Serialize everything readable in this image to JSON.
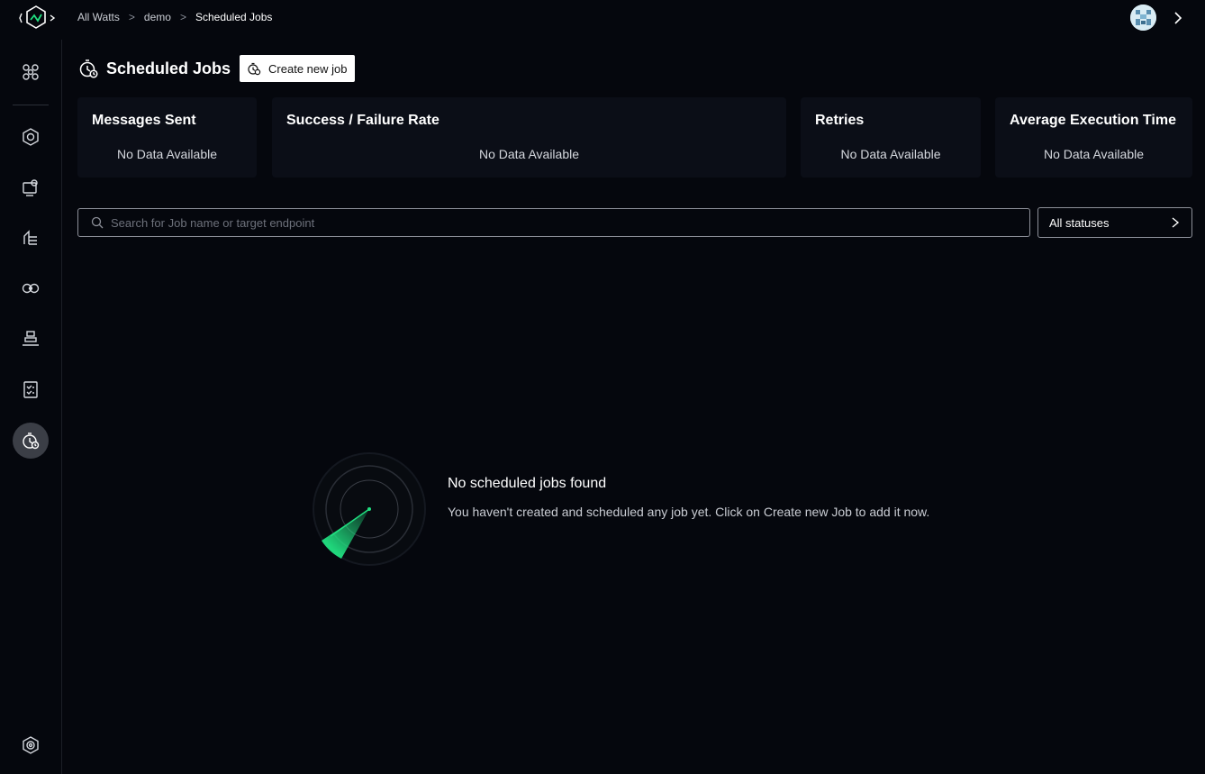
{
  "breadcrumb": {
    "items": [
      "All Watts",
      "demo",
      "Scheduled Jobs"
    ],
    "separator": ">"
  },
  "header": {
    "title": "Scheduled Jobs",
    "create_button_label": "Create new job"
  },
  "metrics": [
    {
      "title": "Messages Sent",
      "value": "No Data Available"
    },
    {
      "title": "Success / Failure Rate",
      "value": "No Data Available"
    },
    {
      "title": "Retries",
      "value": "No Data Available"
    },
    {
      "title": "Average Execution Time",
      "value": "No Data Available"
    }
  ],
  "search": {
    "placeholder": "Search for Job name or target endpoint",
    "value": ""
  },
  "status_filter": {
    "selected": "All statuses"
  },
  "empty_state": {
    "title": "No scheduled jobs found",
    "description": "You haven't created and scheduled any job yet. Click on Create new Job to add it now."
  },
  "sidebar": {
    "items": [
      {
        "icon": "dashboard-icon"
      },
      {
        "icon": "services-icon"
      },
      {
        "icon": "apps-icon"
      },
      {
        "icon": "deploy-icon"
      },
      {
        "icon": "connections-icon"
      },
      {
        "icon": "stack-icon"
      },
      {
        "icon": "checklist-icon"
      },
      {
        "icon": "scheduled-jobs-icon",
        "active": true
      }
    ],
    "bottom_icon": "settings-icon"
  },
  "colors": {
    "background": "#05070d",
    "card": "#0b0e17",
    "accent": "#21e081",
    "active_nav": "#3b3e46"
  }
}
